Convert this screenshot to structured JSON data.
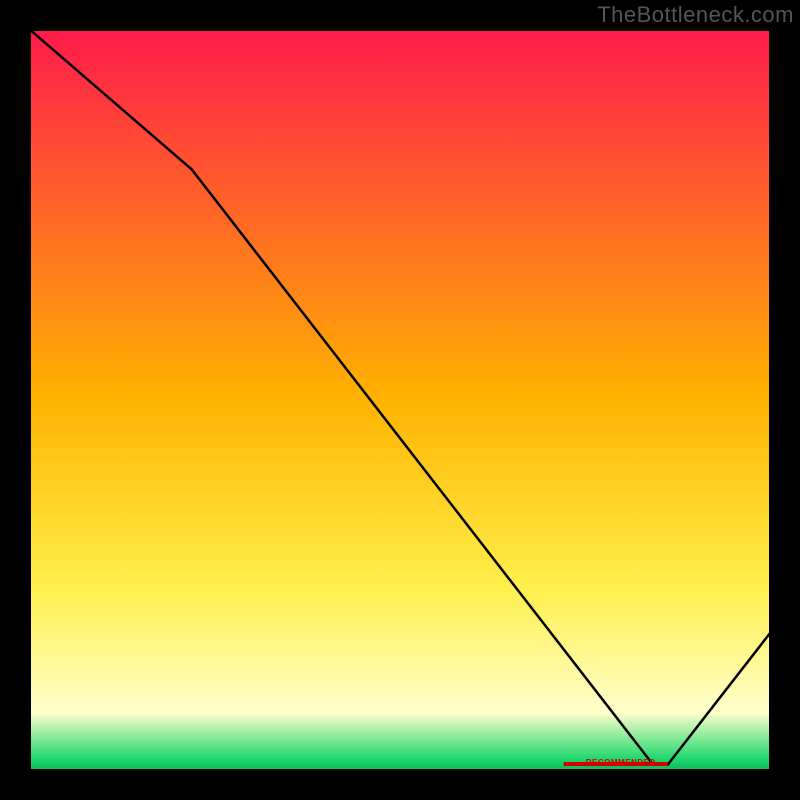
{
  "watermark": "TheBottleneck.com",
  "floor_label": "RECOMMENDED",
  "colors": {
    "top": "#ff1a4b",
    "orange": "#ffb300",
    "yellow": "#ffef4a",
    "pale": "#ffffcc",
    "green": "#17d66a",
    "frame": "#000000",
    "bg": "#000000",
    "curve": "#000000",
    "text": "#555555",
    "floorTxt": "#d00000"
  },
  "chart_data": {
    "type": "line",
    "title": "",
    "xlabel": "",
    "ylabel": "",
    "xlim": [
      0,
      100
    ],
    "ylim": [
      0,
      100
    ],
    "series": [
      {
        "name": "curve",
        "x": [
          0,
          22,
          84,
          86,
          100
        ],
        "y": [
          100,
          81,
          1,
          1,
          19
        ]
      }
    ],
    "gradient_stops": [
      {
        "offset": 0.0,
        "color": "#ff1a4b"
      },
      {
        "offset": 0.5,
        "color": "#ffb300"
      },
      {
        "offset": 0.75,
        "color": "#ffef4a"
      },
      {
        "offset": 0.92,
        "color": "#ffffcc"
      },
      {
        "offset": 0.985,
        "color": "#17d66a"
      },
      {
        "offset": 1.0,
        "color": "#0fae55"
      }
    ],
    "floor_marker_x": [
      72,
      86
    ]
  }
}
